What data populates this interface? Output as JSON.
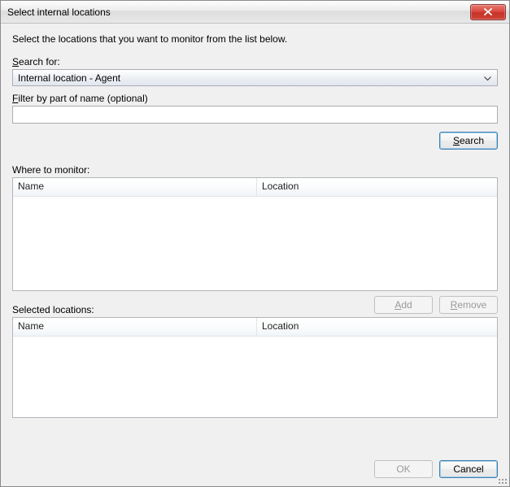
{
  "window": {
    "title": "Select internal locations"
  },
  "instruction": "Select the locations that you want to monitor from the list below.",
  "search": {
    "label_pre": "S",
    "label_rest": "earch for:",
    "selected": "Internal location - Agent",
    "filter_label_pre": "F",
    "filter_label_rest": "ilter by part of name (optional)",
    "filter_value": "",
    "button_pre": "S",
    "button_rest": "earch"
  },
  "monitor": {
    "label": "Where to monitor:",
    "columns": {
      "name": "Name",
      "location": "Location"
    }
  },
  "actions": {
    "add_pre": "A",
    "add_rest": "dd",
    "remove_pre": "R",
    "remove_rest": "emove"
  },
  "selected": {
    "label": "Selected locations:",
    "columns": {
      "name": "Name",
      "location": "Location"
    }
  },
  "footer": {
    "ok": "OK",
    "cancel": "Cancel"
  }
}
